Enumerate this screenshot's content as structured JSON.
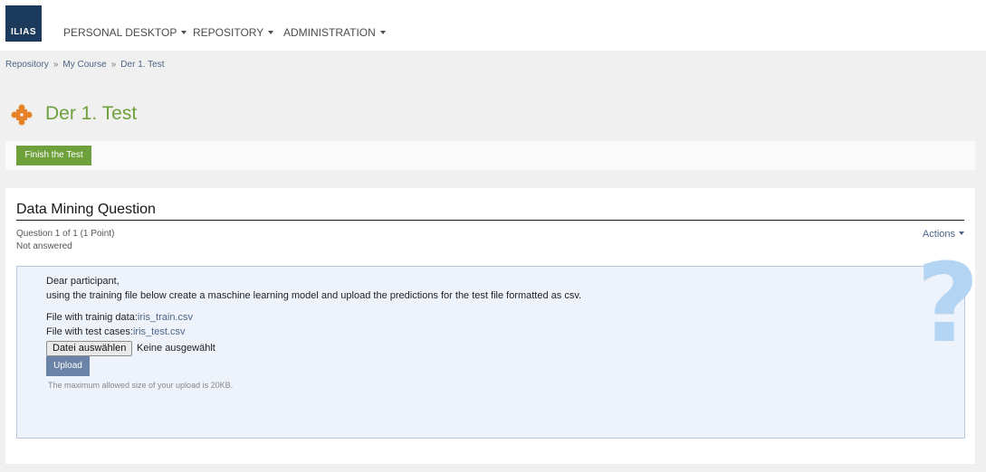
{
  "header": {
    "logo_text": "ILIAS",
    "nav": [
      {
        "label": "PERSONAL DESKTOP"
      },
      {
        "label": "REPOSITORY"
      },
      {
        "label": "ADMINISTRATION"
      }
    ]
  },
  "breadcrumb": [
    "Repository",
    "My Course",
    "Der 1. Test"
  ],
  "breadcrumb_sep": "»",
  "page": {
    "title": "Der 1. Test",
    "title_icon": "puzzle-icon"
  },
  "toolbar": {
    "finish_label": "Finish the Test"
  },
  "question": {
    "title": "Data Mining Question",
    "position": "Question 1 of 1 (1 Point)",
    "status": "Not answered",
    "actions_label": "Actions",
    "greeting": "Dear participant,",
    "instruction": "using the training file below create a maschine learning model and upload the predictions for the test file formatted as csv.",
    "train_label": "File with trainig data:",
    "train_file": "iris_train.csv",
    "test_label": "File with test cases:",
    "test_file": "iris_test.csv",
    "file_button_label": "Datei auswählen",
    "file_status": "Keine ausgewählt",
    "upload_label": "Upload",
    "upload_hint": "The maximum allowed size of your upload is 20KB.",
    "decor_glyph": "?"
  },
  "colors": {
    "title_green": "#6ea03c",
    "link_blue": "#4c6586",
    "logo_navy": "#1b3a5c",
    "upload_button": "#6b83a6",
    "question_box_bg": "#eef3fb"
  }
}
